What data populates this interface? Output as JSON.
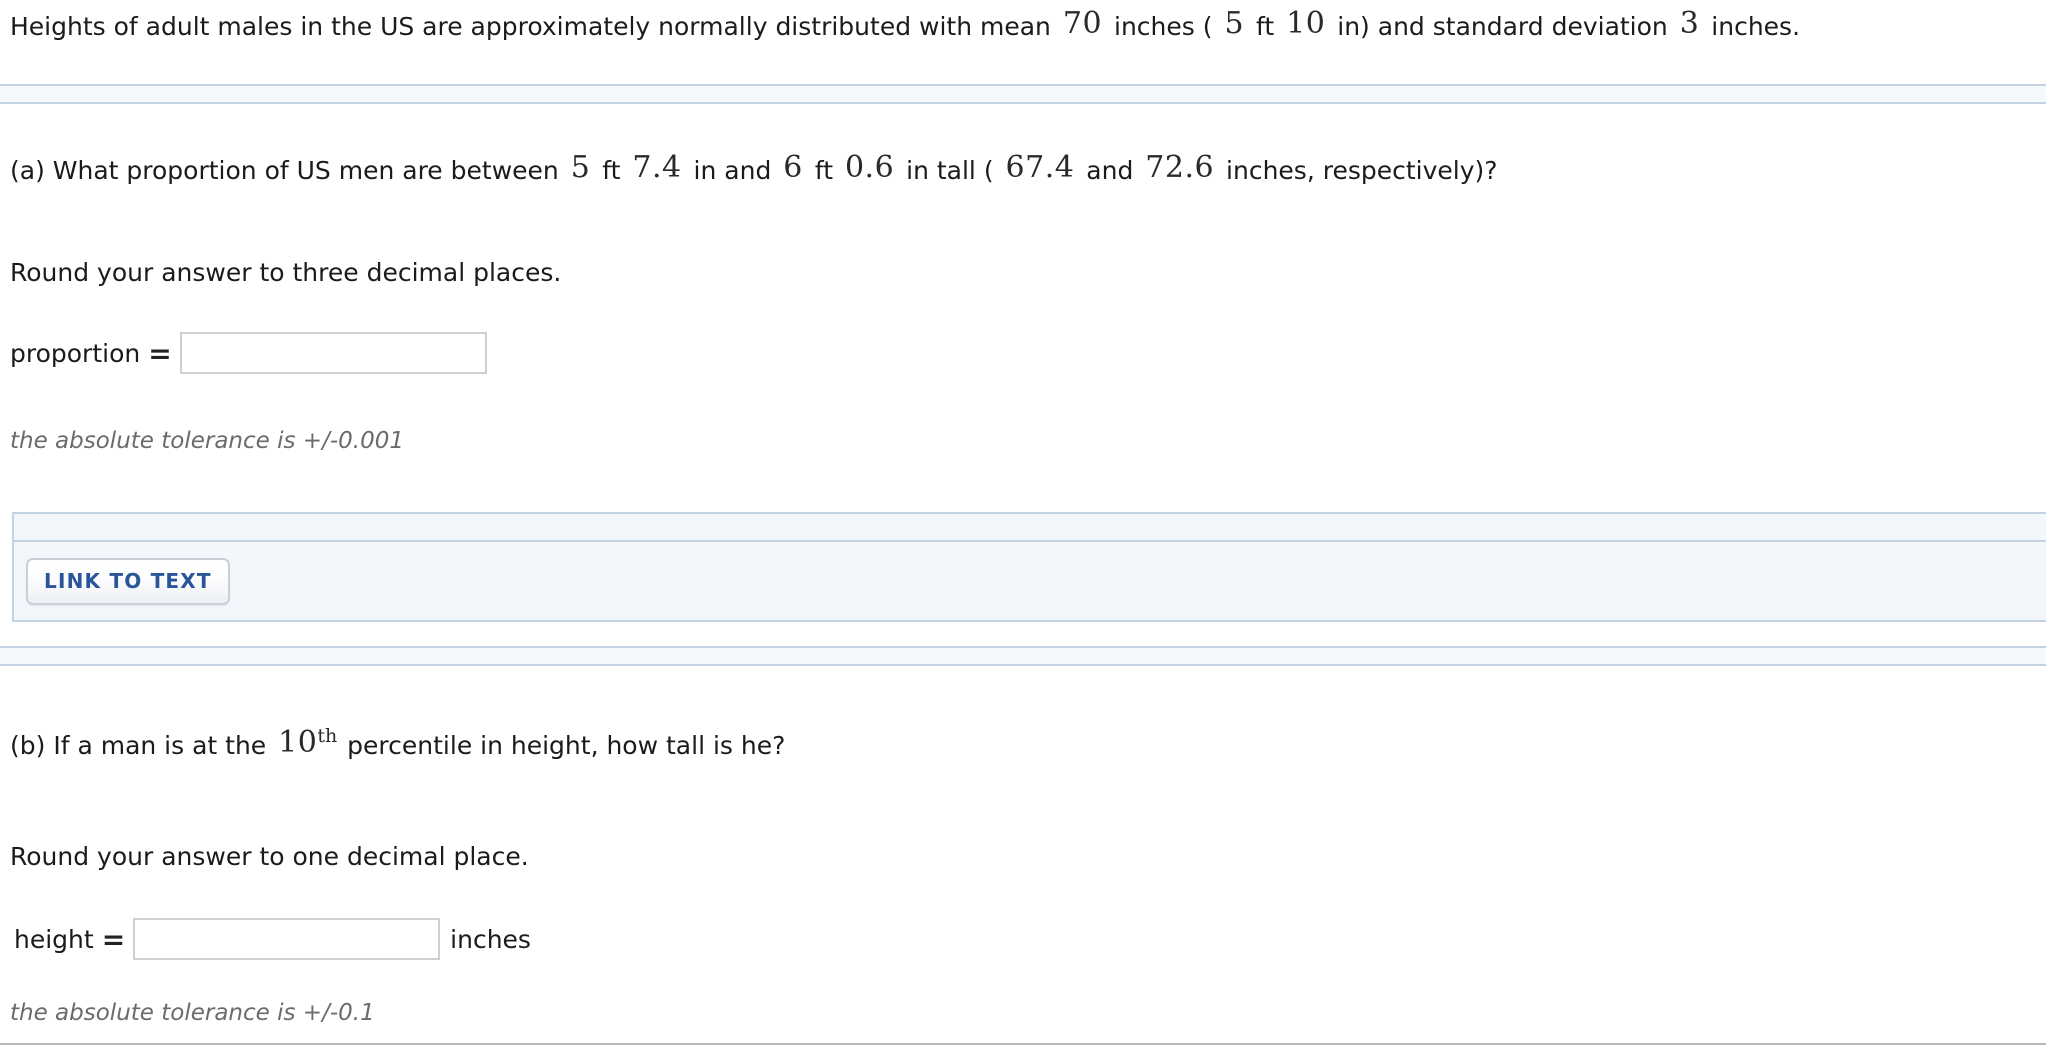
{
  "stem": {
    "text_1": "Heights of adult males in the US are approximately normally distributed with mean",
    "mean_inches": "70",
    "text_2": "inches (",
    "mean_ft": "5",
    "unit_ft": "ft",
    "mean_in": "10",
    "text_3": "in) and standard deviation",
    "sd_inches": "3",
    "text_4": "inches."
  },
  "part_a": {
    "question_1": "(a) What proportion of US men are between",
    "low_ft": "5",
    "unit_ft_1": "ft",
    "low_in": "7.4",
    "question_2": "in and",
    "high_ft": "6",
    "unit_ft_2": "ft",
    "high_in": "0.6",
    "question_3": "in tall (",
    "low_inches": "67.4",
    "question_4": "and",
    "high_inches": "72.6",
    "question_5": "inches, respectively)?",
    "round_note": "Round your answer to three decimal places.",
    "answer_label": "proportion",
    "equals": "=",
    "answer_value": "",
    "answer_placeholder": "",
    "tolerance": "the absolute tolerance is +/-0.001"
  },
  "link_panel": {
    "button_label": "LINK TO TEXT"
  },
  "part_b": {
    "question_1": "(b) If a man is at the",
    "percentile_number": "10",
    "percentile_suffix": "th",
    "question_2": "percentile in height, how tall is he?",
    "round_note": "Round your answer to one decimal place.",
    "answer_label": "height",
    "equals": "=",
    "answer_value": "",
    "answer_placeholder": "",
    "unit": "inches",
    "tolerance": "the absolute tolerance is +/-0.1"
  },
  "colors": {
    "panel_background": "#f3f7fb",
    "panel_border": "#c3d3e3",
    "button_text": "#2a5599",
    "input_border": "#cfcfcf",
    "tolerance_text": "#6b6b6b",
    "body_text": "#1b1b1b"
  }
}
